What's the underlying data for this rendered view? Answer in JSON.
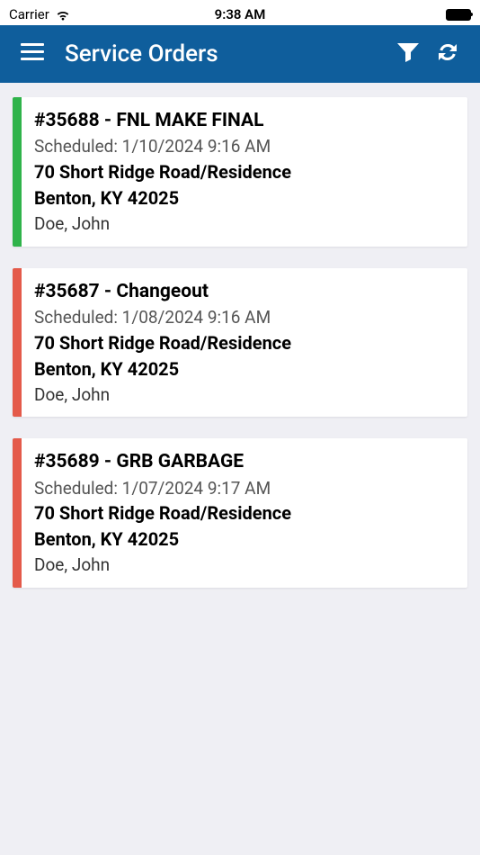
{
  "status_bar": {
    "carrier": "Carrier",
    "time": "9:38 AM"
  },
  "header": {
    "title": "Service Orders"
  },
  "colors": {
    "header_bg": "#0f5e9c",
    "green": "#2fb34a",
    "red": "#e45a4a",
    "page_bg": "#efeff4"
  },
  "orders": [
    {
      "accent": "green",
      "title": "#35688 - FNL MAKE FINAL",
      "scheduled": "Scheduled: 1/10/2024 9:16 AM",
      "address_line1": "70 Short Ridge Road/Residence",
      "address_line2": "Benton, KY 42025",
      "name": "Doe, John"
    },
    {
      "accent": "red",
      "title": "#35687 - Changeout",
      "scheduled": "Scheduled: 1/08/2024 9:16 AM",
      "address_line1": "70 Short Ridge Road/Residence",
      "address_line2": "Benton, KY 42025",
      "name": "Doe, John"
    },
    {
      "accent": "red",
      "title": "#35689 - GRB GARBAGE",
      "scheduled": "Scheduled: 1/07/2024 9:17 AM",
      "address_line1": "70 Short Ridge Road/Residence",
      "address_line2": "Benton, KY 42025",
      "name": "Doe, John"
    }
  ]
}
